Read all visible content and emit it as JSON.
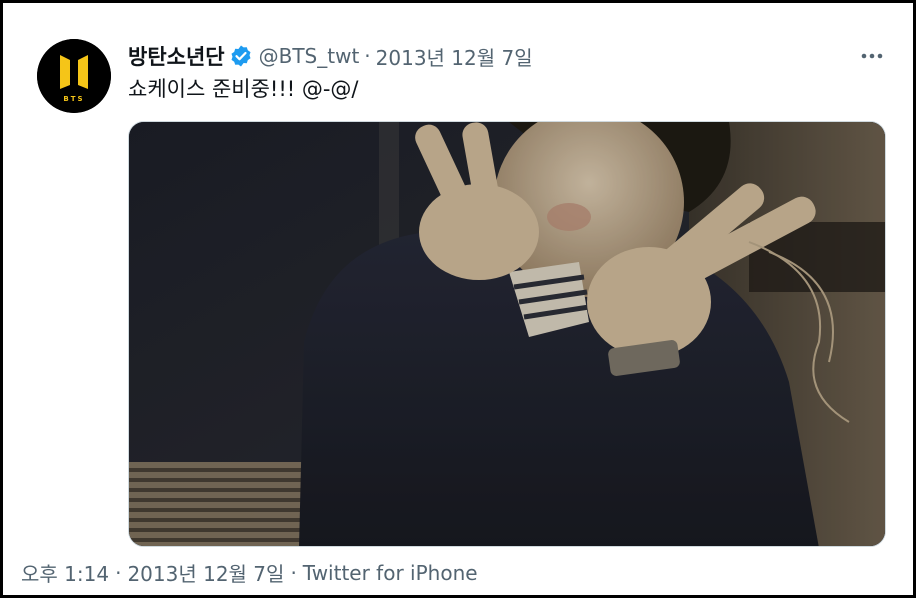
{
  "tweet": {
    "display_name": "방탄소년단",
    "handle": "@BTS_twt",
    "separator": "·",
    "date": "2013년 12월 7일",
    "text": "쇼케이스 준비중!!! @-@/",
    "avatar": {
      "logo_text": "BTS",
      "background": "#000000",
      "logo_color": "#f5c518"
    },
    "verified_color": "#1d9bf0"
  },
  "footer": {
    "time": "오후 1:14",
    "separator": "·",
    "date": "2013년 12월 7일",
    "source": "Twitter for iPhone"
  },
  "icons": {
    "more": "more-horizontal-icon",
    "verified": "verified-badge-icon"
  }
}
